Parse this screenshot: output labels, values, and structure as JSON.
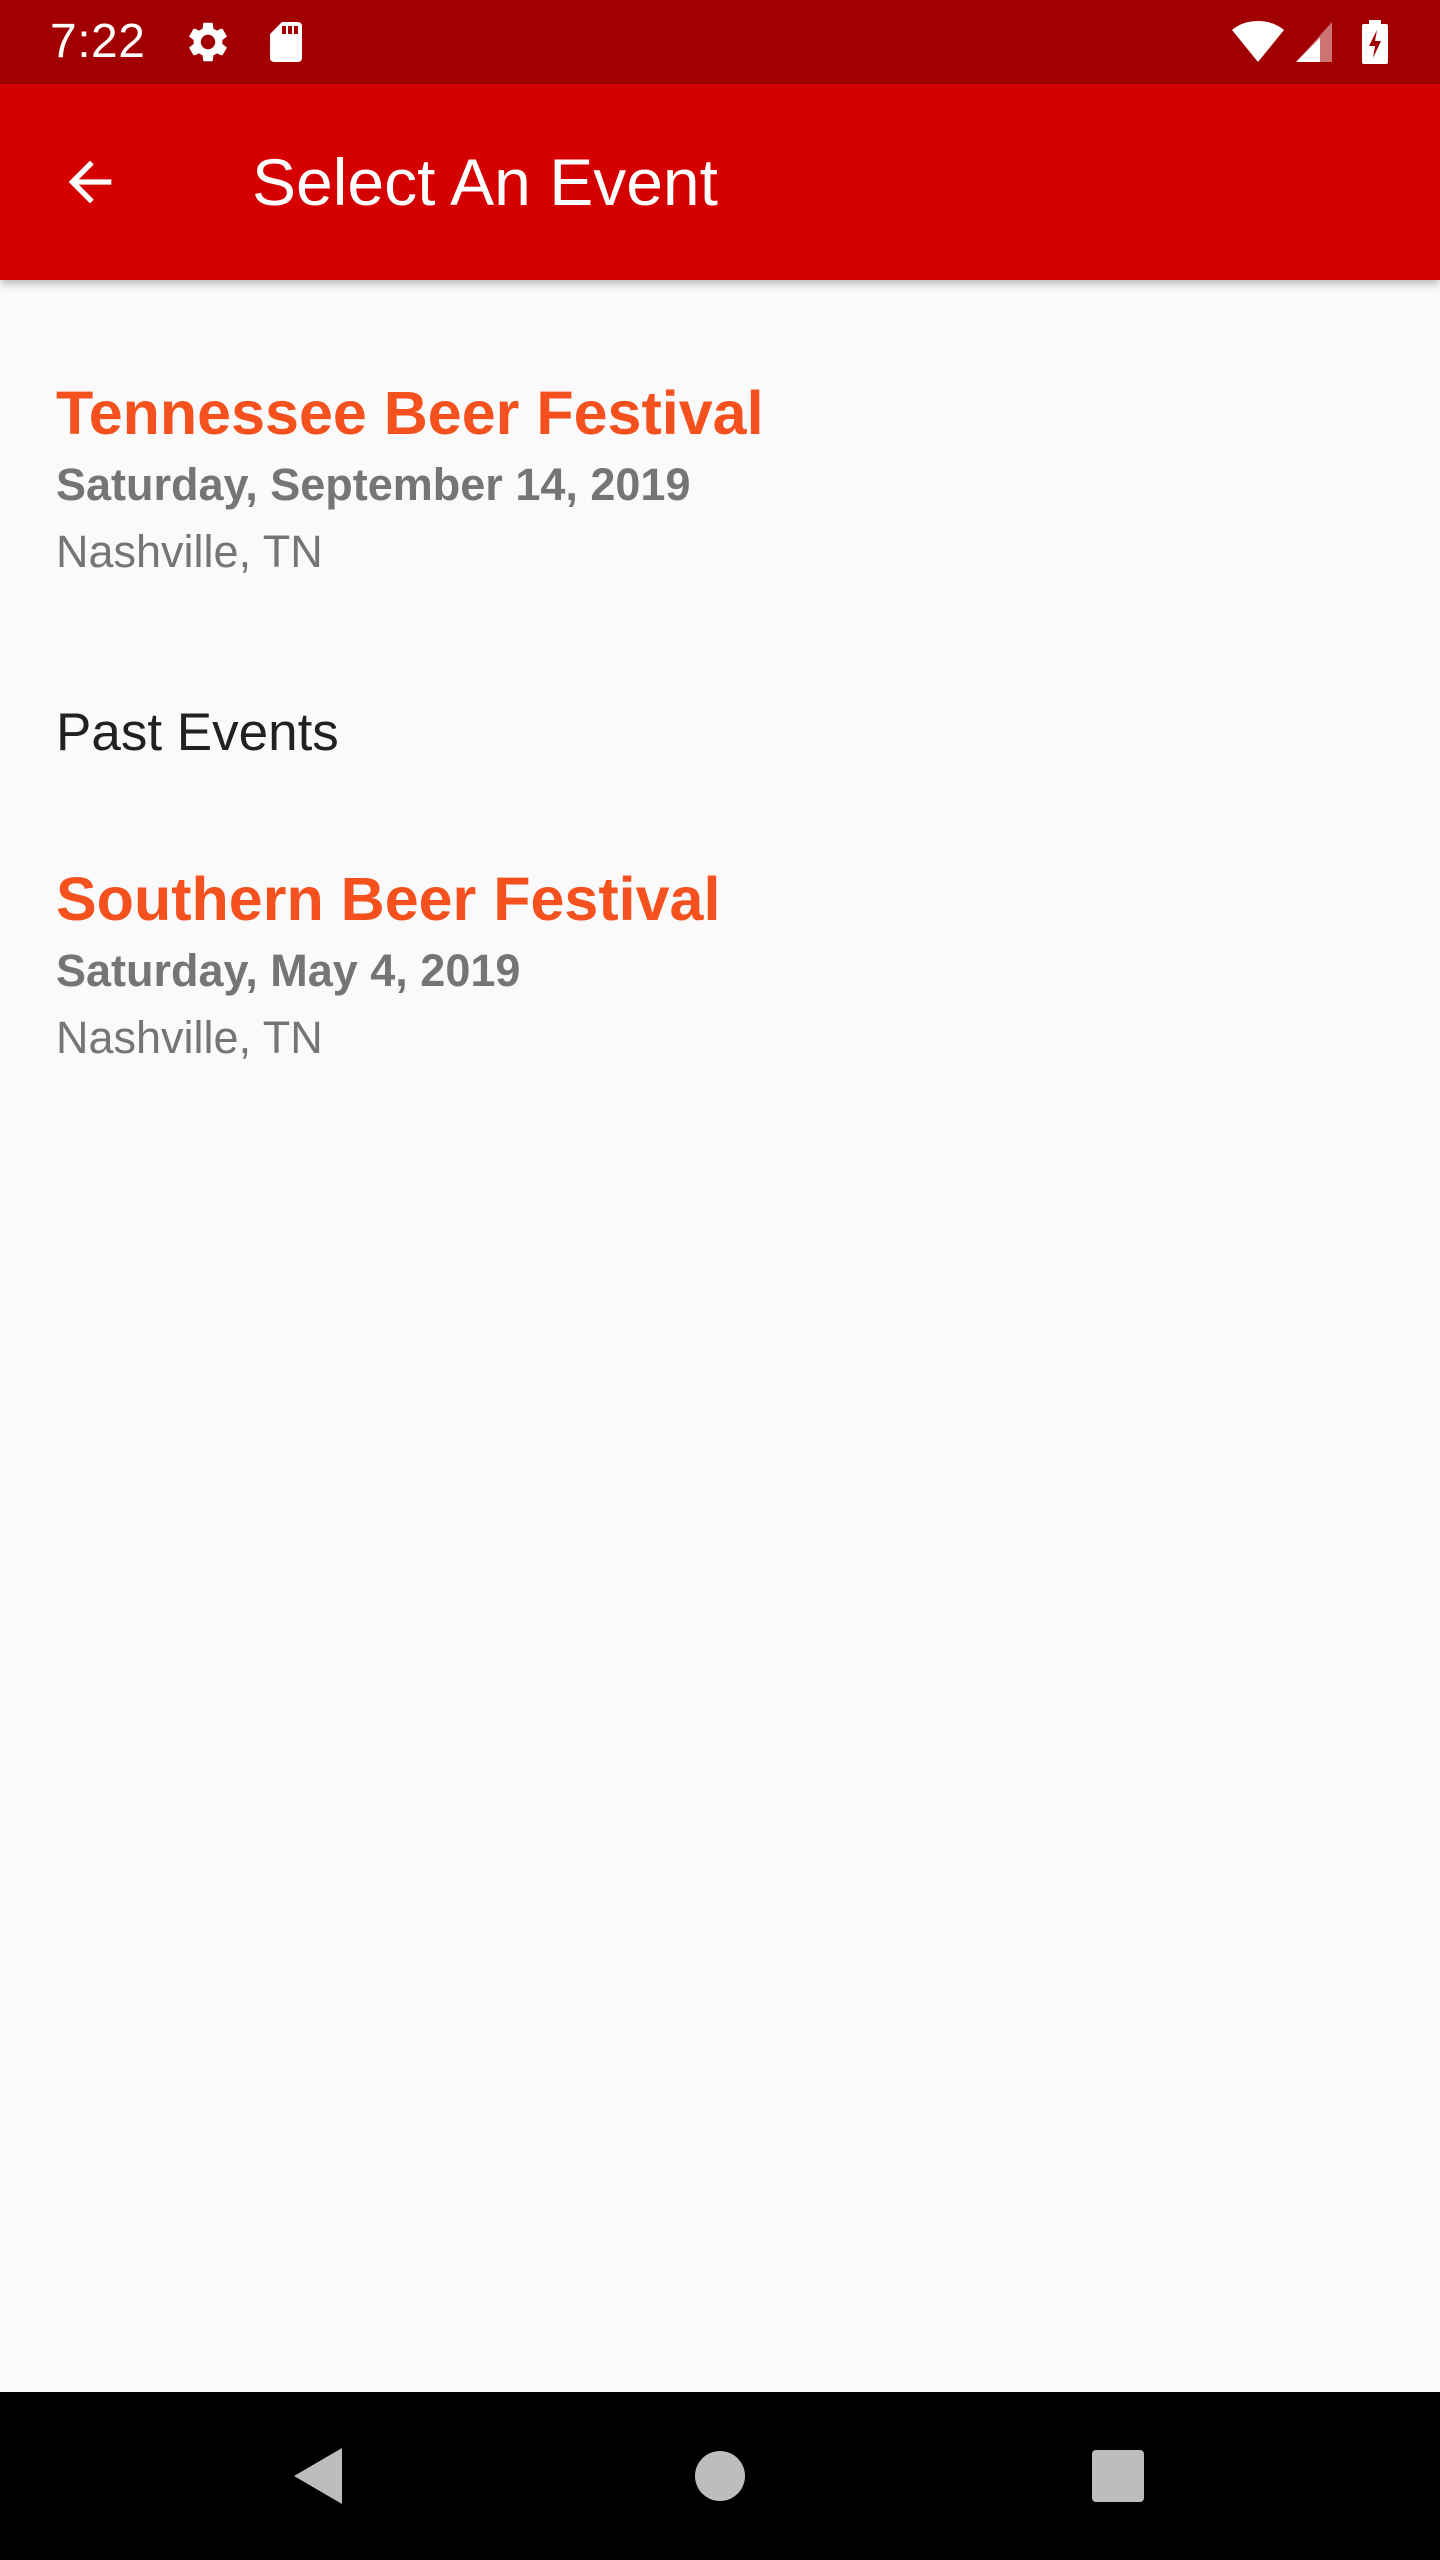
{
  "status_bar": {
    "time": "7:22",
    "icons": [
      "settings-icon",
      "sd-card-icon",
      "wifi-icon",
      "cellular-signal-icon",
      "battery-charging-icon"
    ]
  },
  "app_bar": {
    "title": "Select An Event",
    "back_icon": "arrow-back-icon"
  },
  "events": [
    {
      "title": "Tennessee Beer Festival",
      "date": "Saturday, September 14, 2019",
      "location": "Nashville, TN"
    }
  ],
  "past_section": {
    "heading": "Past Events",
    "events": [
      {
        "title": "Southern Beer Festival",
        "date": "Saturday, May 4, 2019",
        "location": "Nashville, TN"
      }
    ]
  },
  "nav_bar": {
    "icons": [
      "nav-back-icon",
      "nav-home-icon",
      "nav-recents-icon"
    ]
  },
  "colors": {
    "status_bar": "#a20000",
    "app_bar": "#d50000",
    "accent_title": "#f4511e",
    "secondary_text": "#757575",
    "background": "#fafafa"
  }
}
